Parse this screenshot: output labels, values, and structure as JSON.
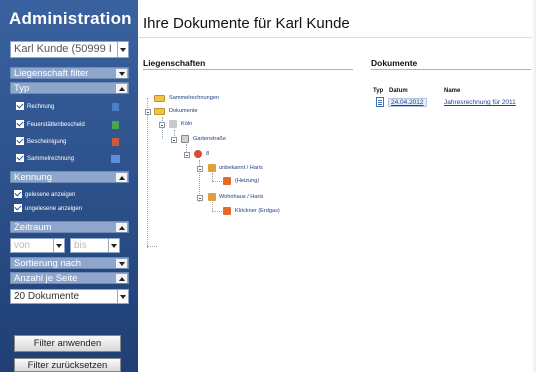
{
  "sidebar": {
    "title": "Administration",
    "person_select": "Karl Kunde (50999 I",
    "liegenschaft_filter": "Liegenschaft filter",
    "typ_header": "Typ",
    "typ_items": [
      {
        "label": "Rechnung",
        "checked": true,
        "icon": "invoice-icon"
      },
      {
        "label": "Feuerstättenbescheid",
        "checked": true,
        "icon": "fireplace-doc-icon"
      },
      {
        "label": "Bescheinigung",
        "checked": true,
        "icon": "certificate-icon"
      },
      {
        "label": "Sammelrechnung",
        "checked": true,
        "icon": "collective-invoice-icon"
      }
    ],
    "kennung_header": "Kennung",
    "kennung_items": [
      {
        "label": "gelesene anzeigen",
        "checked": true
      },
      {
        "label": "ungelesene anzeigen",
        "checked": true
      }
    ],
    "zeitraum_header": "Zeitraum",
    "zeitraum_von": "von",
    "zeitraum_bis": "bis",
    "sortierung_header": "Sortierung nach",
    "anzahl_header": "Anzahl je Seite",
    "anzahl_value": "20 Dokumente",
    "apply_button": "Filter anwenden",
    "reset_button": "Filter zurücksetzen"
  },
  "main": {
    "title": "Ihre Dokumente für Karl Kunde",
    "col_liegenschaften": "Liegenschaften",
    "col_dokumente": "Dokumente",
    "tree": [
      {
        "label": "Sammelrechnungen"
      },
      {
        "label": "Dokumente"
      },
      {
        "label": "Köln"
      },
      {
        "label": "Gartenstraße"
      },
      {
        "label": "8"
      },
      {
        "label": "unbekannt / Haris"
      },
      {
        "label": "(Heizung)"
      },
      {
        "label": "Wohnhaus / Haris"
      },
      {
        "label": "Klöckner (Erdgas)"
      }
    ],
    "docs_columns": {
      "typ": "Typ",
      "datum": "Datum",
      "name": "Name"
    },
    "docs": [
      {
        "date": "24.04.2012",
        "name": "Jahresrechnung für 2011"
      }
    ]
  },
  "colors": {
    "sidebar": "#2d5290",
    "link": "#1c3f9a",
    "folder": "#f0c34e"
  }
}
